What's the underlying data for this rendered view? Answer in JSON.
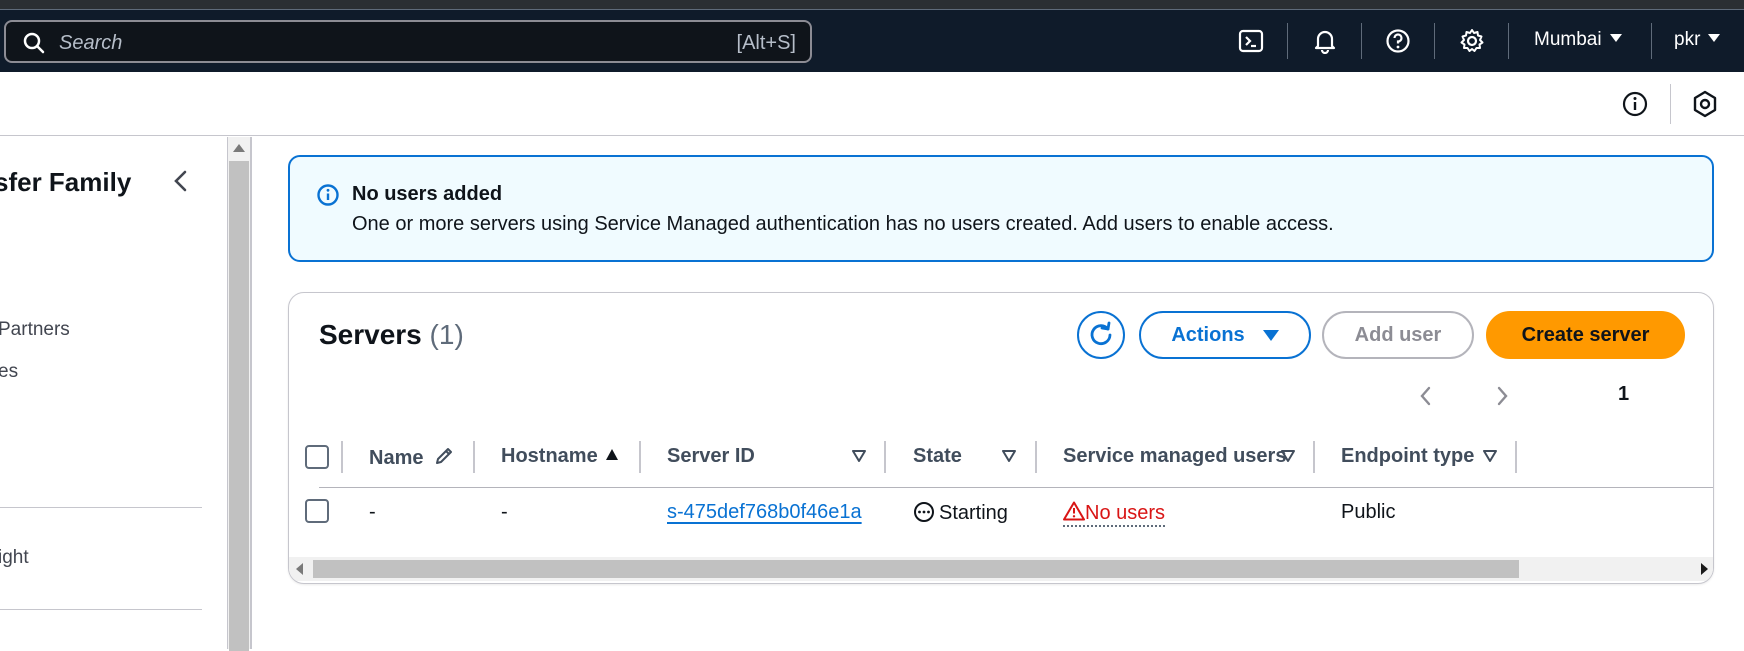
{
  "topbar": {
    "search_placeholder": "Search",
    "search_shortcut": "[Alt+S]",
    "region": "Mumbai",
    "user": "pkr"
  },
  "sidebar": {
    "title": "sfer Family",
    "items": [
      {
        "label": "Partners"
      },
      {
        "label": "es"
      },
      {
        "label": "ight"
      }
    ]
  },
  "alert": {
    "title": "No users added",
    "message": "One or more servers using Service Managed authentication has no users created. Add users to enable access."
  },
  "servers": {
    "title": "Servers",
    "count": "(1)",
    "actions_label": "Actions",
    "add_user_label": "Add user",
    "create_server_label": "Create server",
    "page": "1",
    "columns": [
      "Name",
      "Hostname",
      "Server ID",
      "State",
      "Service managed users",
      "Endpoint type"
    ],
    "rows": [
      {
        "name": "-",
        "hostname": "-",
        "server_id": "s-475def768b0f46e1a",
        "state": "Starting",
        "service_managed_users": "No users",
        "endpoint_type": "Public"
      }
    ]
  },
  "colors": {
    "topbar": "#0f1b2a",
    "link": "#0972d3",
    "primary_button": "#ff9900",
    "error": "#d91515",
    "alert_bg": "#f0fbff"
  }
}
